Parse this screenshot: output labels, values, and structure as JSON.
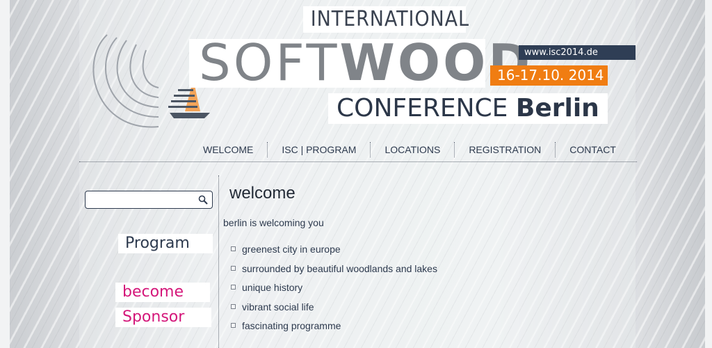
{
  "header": {
    "title_line1": "INTERNATIONAL",
    "title_soft": "SOFT",
    "title_wood": "WOOD",
    "title_line3": "CONFERENCE",
    "title_city": "Berlin",
    "url": "www.isc2014.de",
    "dates": "16-17.10. 2014"
  },
  "nav": {
    "items": [
      {
        "label": "WELCOME"
      },
      {
        "label": "ISC | PROGRAM"
      },
      {
        "label": "LOCATIONS"
      },
      {
        "label": "REGISTRATION"
      },
      {
        "label": "CONTACT"
      }
    ]
  },
  "sidebar": {
    "search": {
      "placeholder": "",
      "value": "",
      "icon": "search-icon"
    },
    "program_label": "Program",
    "become_label": "become",
    "sponsor_label": "Sponsor"
  },
  "main": {
    "heading": "welcome",
    "intro": "berlin is welcoming you",
    "bullets": [
      "greenest city in europe",
      "surrounded by beautiful woodlands and lakes",
      "unique history",
      "vibrant social life",
      "fascinating programme"
    ]
  },
  "colors": {
    "navy": "#2f3e55",
    "orange": "#f07d12",
    "magenta": "#d4177a",
    "grey_title": "#808489"
  }
}
